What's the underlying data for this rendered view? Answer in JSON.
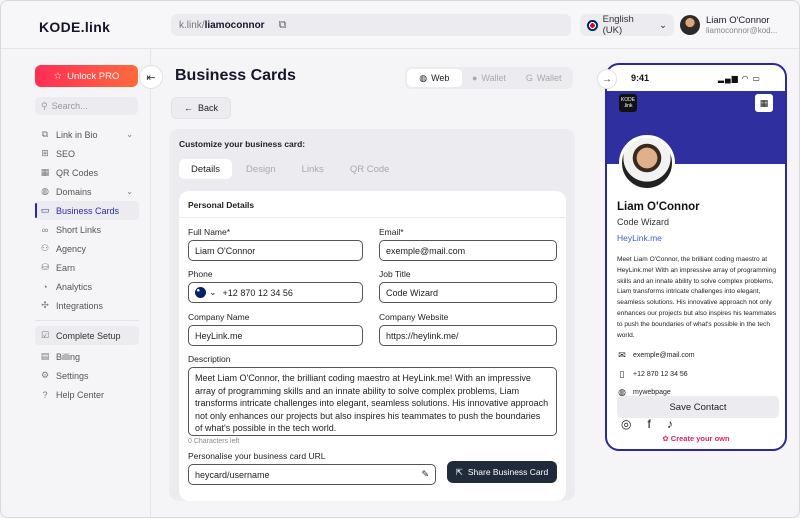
{
  "app": {
    "logo": "KODE.link",
    "url_prefix": "k.link/",
    "url_user": "liamoconnor",
    "language": "English (UK)",
    "user_name": "Liam O'Connor",
    "user_email": "liamoconnor@kod..."
  },
  "sidebar": {
    "pro_label": "Unlock PRO",
    "search_placeholder": "Search...",
    "items": [
      {
        "label": "Link in Bio",
        "icon": "link-icon"
      },
      {
        "label": "SEO",
        "icon": "seo-icon"
      },
      {
        "label": "QR Codes",
        "icon": "qr-icon"
      },
      {
        "label": "Domains",
        "icon": "globe-icon"
      },
      {
        "label": "Business Cards",
        "icon": "card-icon"
      },
      {
        "label": "Short Links",
        "icon": "short-link-icon"
      },
      {
        "label": "Agency",
        "icon": "agency-icon"
      },
      {
        "label": "Earn",
        "icon": "earn-icon"
      },
      {
        "label": "Analytics",
        "icon": "analytics-icon"
      },
      {
        "label": "Integrations",
        "icon": "integrations-icon"
      },
      {
        "label": "Complete Setup",
        "icon": "checklist-icon"
      },
      {
        "label": "Billing",
        "icon": "billing-icon"
      },
      {
        "label": "Settings",
        "icon": "gear-icon"
      },
      {
        "label": "Help Center",
        "icon": "help-icon"
      }
    ]
  },
  "main": {
    "title": "Business Cards",
    "view_tabs": [
      "Web",
      "Wallet",
      "Wallet"
    ],
    "back_label": "Back",
    "customize_label": "Customize your business card:",
    "tabs": [
      "Details",
      "Design",
      "Links",
      "QR Code"
    ],
    "section_title": "Personal Details",
    "form": {
      "full_name_label": "Full Name*",
      "full_name": "Liam O'Connor",
      "email_label": "Email*",
      "email": "exemple@mail.com",
      "phone_label": "Phone",
      "phone": "+12 870 12 34 56",
      "job_label": "Job Title",
      "job": "Code Wizard",
      "company_label": "Company Name",
      "company": "HeyLink.me",
      "website_label": "Company Website",
      "website": "https://heylink.me/",
      "description_label": "Description",
      "description": "Meet Liam O'Connor, the brilliant coding maestro at HeyLink.me! With an impressive array of programming skills and an innate ability to solve complex problems, Liam transforms intricate challenges into elegant, seamless solutions. His innovative approach not only enhances our projects but also inspires his teammates to push the boundaries of what's possible in the tech world.",
      "counter": "0 Characters left",
      "url_label": "Personalise your business card URL",
      "url_value": "heycard/username",
      "share_label": "Share Business Card"
    }
  },
  "preview": {
    "time": "9:41",
    "brand": "KODE .link",
    "name": "Liam O'Connor",
    "role": "Code Wizard",
    "link": "HeyLink.me",
    "bio": "Meet Liam O'Connor, the brilliant coding maestro at HeyLink.me! With an impressive array of programming skills and an innate ability to solve complex problems, Liam transforms intricate challenges into elegant, seamless solutions. His innovative approach not only enhances our projects but also inspires his teammates to push the boundaries of what's possible in the tech world.",
    "email": "exemple@mail.com",
    "phone": "+12 870 12 34 56",
    "web": "mywebpage",
    "save_label": "Save Contact",
    "create_label": "Create your own"
  }
}
